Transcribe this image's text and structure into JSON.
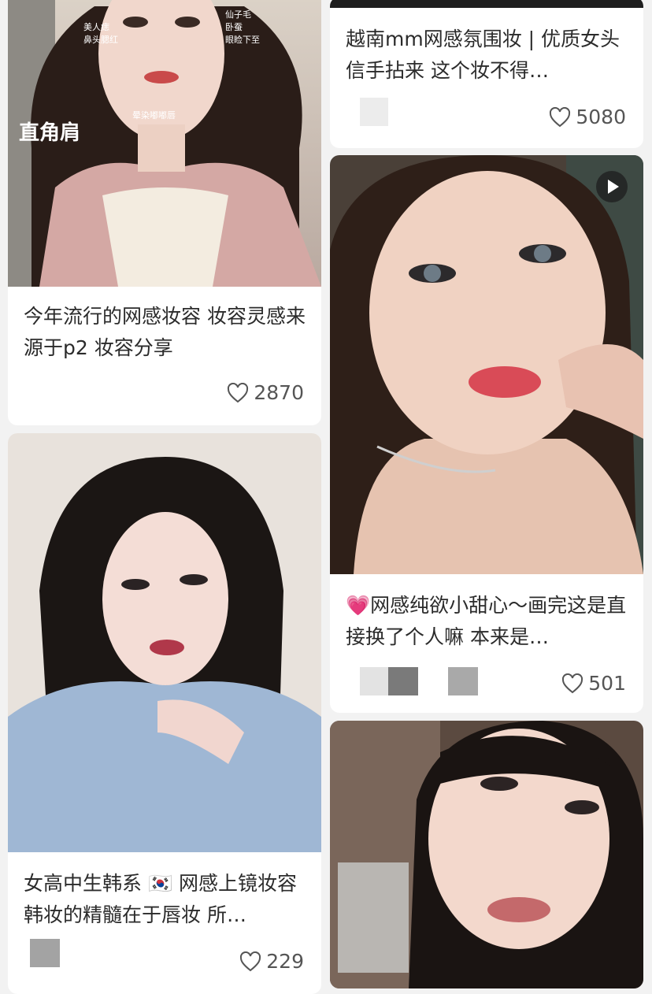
{
  "cards": [
    {
      "id": "c1",
      "overlay_big": "直角肩",
      "overlay_small": [
        "美人痣",
        "鼻头腮红",
        "仙子毛",
        "卧蚕",
        "眼睑下至",
        "晕染嘟嘟唇"
      ],
      "title": "今年流行的网感妆容 妆容灵感来源于p2 妆容分享",
      "likes": "2870"
    },
    {
      "id": "c2",
      "title": "越南mm网感氛围妆 | 优质女头信手拈来 这个妆不得…",
      "likes": "5080"
    },
    {
      "id": "c3",
      "title": "💗网感纯欲小甜心～画完这是直接换了个人嘛 本来是…",
      "likes": "501"
    },
    {
      "id": "c4",
      "title": "女高中生韩系 🇰🇷 网感上镜妆容 韩妆的精髓在于唇妆 所…",
      "likes": "229"
    },
    {
      "id": "c5"
    }
  ],
  "colors": {
    "background": "#f2f2f2",
    "card": "#ffffff",
    "text": "#2b2b2b",
    "meta": "#555555"
  }
}
